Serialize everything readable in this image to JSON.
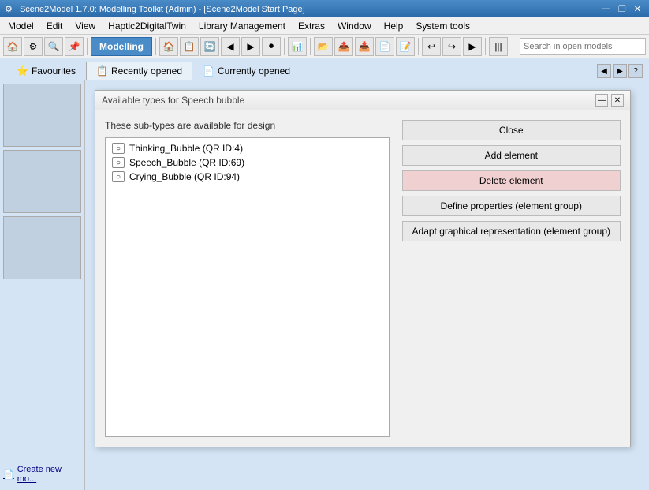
{
  "titleBar": {
    "title": "Scene2Model 1.7.0: Modelling Toolkit (Admin) - [Scene2Model Start Page]",
    "minimizeLabel": "—",
    "restoreLabel": "❐",
    "closeLabel": "✕"
  },
  "menuBar": {
    "items": [
      {
        "label": "Model"
      },
      {
        "label": "Edit"
      },
      {
        "label": "View"
      },
      {
        "label": "Haptic2DigitalTwin"
      },
      {
        "label": "Library Management"
      },
      {
        "label": "Extras"
      },
      {
        "label": "Window"
      },
      {
        "label": "Help"
      },
      {
        "label": "System tools"
      }
    ]
  },
  "toolbar": {
    "modellingLabel": "Modelling",
    "searchPlaceholder": "Search in open models"
  },
  "tabs": {
    "favourites": "Favourites",
    "recentlyOpened": "Recently opened",
    "currentlyOpened": "Currently opened",
    "navPrev": "◀",
    "navNext": "▶",
    "navHelp": "?"
  },
  "sidebar": {
    "createLabel": "Create new mo..."
  },
  "dialog": {
    "title": "Available types for Speech bubble",
    "subtitle": "These sub-types are available for design",
    "items": [
      {
        "label": "Thinking_Bubble (QR ID:4)"
      },
      {
        "label": "Speech_Bubble (QR ID:69)"
      },
      {
        "label": "Crying_Bubble (QR ID:94)"
      }
    ],
    "buttons": {
      "close": "Close",
      "addElement": "Add element",
      "deleteElement": "Delete element",
      "defineProperties": "Define properties (element group)",
      "adaptGraphical": "Adapt graphical representation (element group)"
    }
  }
}
